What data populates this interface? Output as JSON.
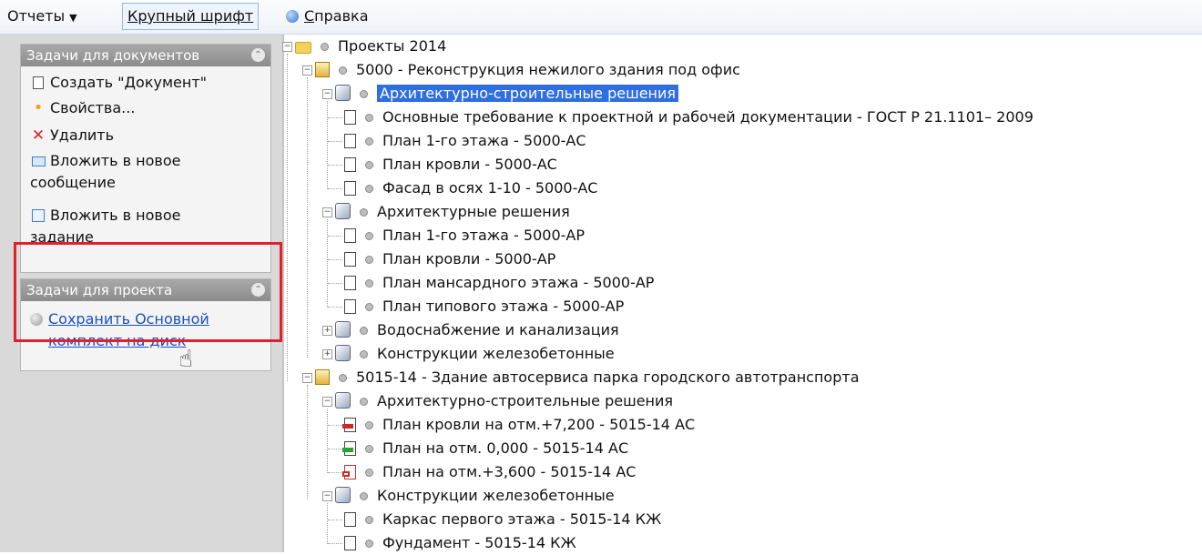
{
  "menu": {
    "reports": "Отчеты",
    "big_font_first": "К",
    "big_font_rest": "рупный шрифт",
    "help_first": "С",
    "help_rest": "правка"
  },
  "doc_tasks": {
    "header": "Задачи для документов",
    "items": [
      {
        "label": "Создать \"Документ\"",
        "icon": "document-icon"
      },
      {
        "label": "Свойства...",
        "icon": "properties-icon"
      },
      {
        "label": "Удалить",
        "icon": "delete-icon"
      },
      {
        "label": "Вложить в новое сообщение",
        "line1": "Вложить в новое",
        "line2": "сообщение",
        "icon": "mail-icon"
      },
      {
        "label": "Вложить в новое задание",
        "line1": "Вложить в новое",
        "line2": "задание",
        "icon": "task-icon"
      }
    ]
  },
  "project_tasks": {
    "header": "Задачи для проекта",
    "link_line1": "Сохранить Основной",
    "link_line2": "комплект на диск"
  },
  "tree": {
    "root": "Проекты 2014",
    "projects": [
      {
        "label": "5000 - Реконструкция нежилого здания под офис",
        "sets": [
          {
            "label": "Архитектурно-строительные решения",
            "selected": true,
            "docs": [
              "Основные требование к проектной и рабочей документации - ГОСТ Р 21.1101– 2009",
              "План 1-го этажа - 5000-АС",
              "План кровли - 5000-АС",
              "Фасад в осях 1-10 - 5000-АС"
            ]
          },
          {
            "label": "Архитектурные решения",
            "docs": [
              "План 1-го этажа - 5000-АР",
              "План кровли - 5000-АР",
              "План мансардного этажа - 5000-АР",
              "План типового этажа - 5000-АР"
            ]
          },
          {
            "label": "Водоснабжение и канализация",
            "docs": []
          },
          {
            "label": "Конструкции железобетонные",
            "docs": []
          }
        ]
      },
      {
        "label": "5015-14 - Здание автосервиса парка городского автотранспорта",
        "sets": [
          {
            "label": "Архитектурно-строительные решения",
            "docs": [
              "План кровли на отм.+7,200 - 5015-14 АС",
              "План на отм. 0,000 - 5015-14 АС",
              "План на отм.+3,600 - 5015-14 АС"
            ]
          },
          {
            "label": "Конструкции железобетонные",
            "docs": [
              "Каркас первого этажа - 5015-14 КЖ",
              "Фундамент - 5015-14 КЖ"
            ]
          }
        ]
      }
    ]
  },
  "colors": {
    "selection": "#2e6ee0",
    "link": "#1a4fc6",
    "highlight_frame": "#e0202b",
    "status_red": "#d42525",
    "status_green": "#25a52f"
  }
}
